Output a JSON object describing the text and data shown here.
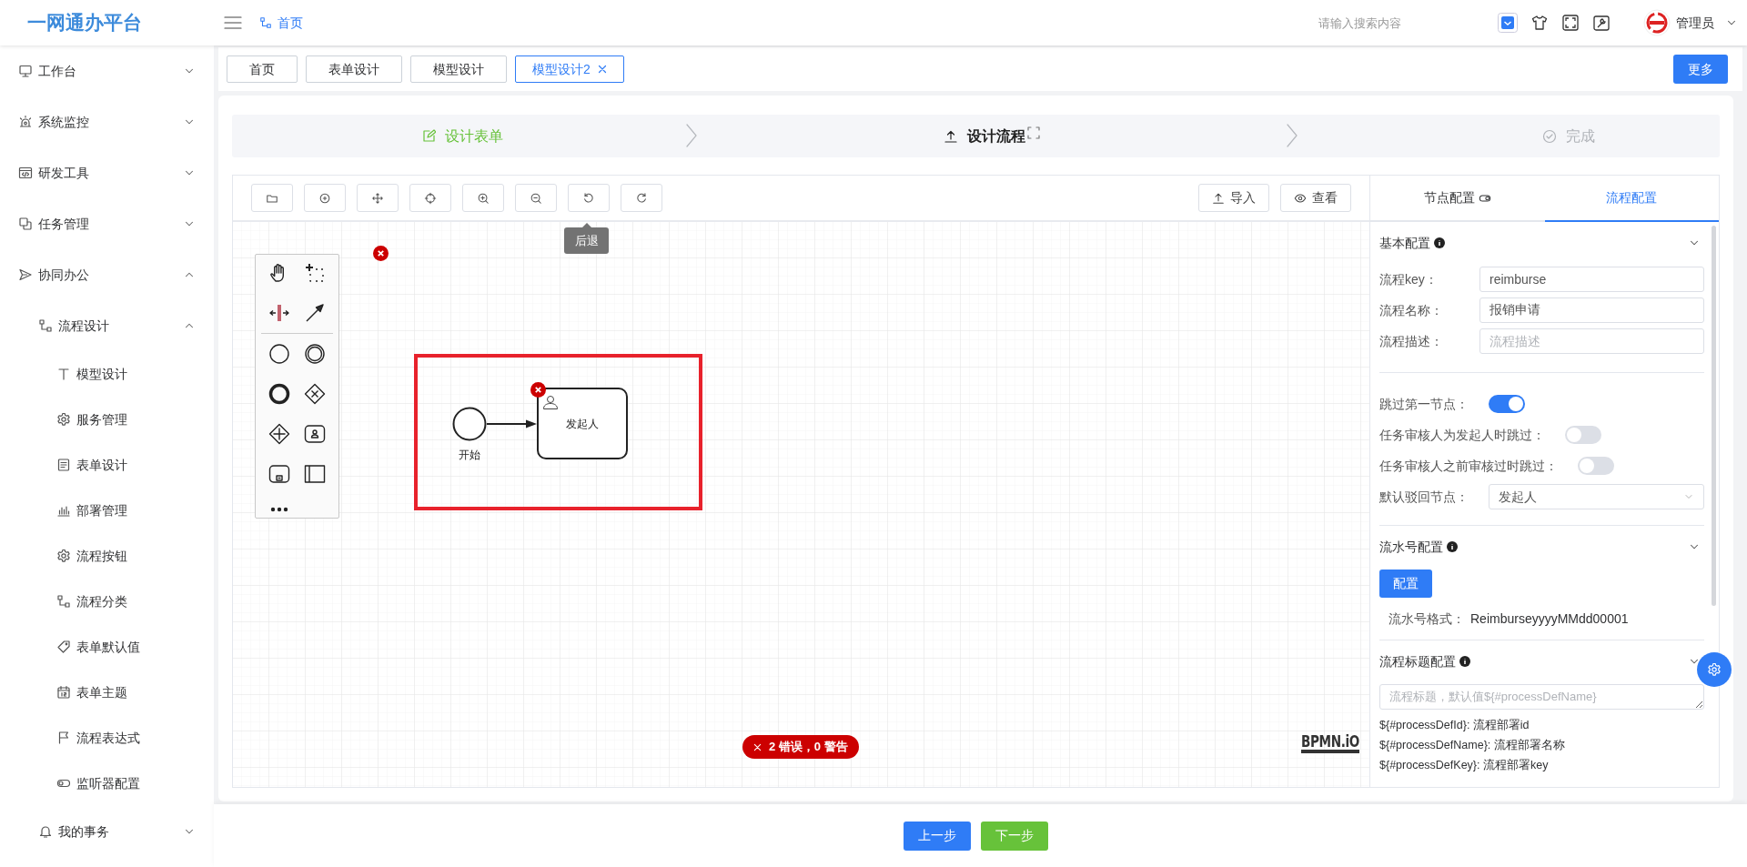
{
  "header": {
    "logo": "一网通办平台",
    "breadcrumb": "首页",
    "search": {
      "placeholder": "请输入搜索内容"
    },
    "user": "管理员"
  },
  "sidebar": {
    "items": [
      {
        "label": "工作台",
        "expanded": false
      },
      {
        "label": "系统监控",
        "expanded": false
      },
      {
        "label": "研发工具",
        "expanded": false
      },
      {
        "label": "任务管理",
        "expanded": false
      },
      {
        "label": "协同办公",
        "expanded": true,
        "children": [
          {
            "label": "流程设计",
            "expanded": true,
            "children": [
              {
                "label": "模型设计"
              },
              {
                "label": "服务管理"
              },
              {
                "label": "表单设计"
              },
              {
                "label": "部署管理"
              },
              {
                "label": "流程按钮"
              },
              {
                "label": "流程分类"
              },
              {
                "label": "表单默认值"
              },
              {
                "label": "表单主题"
              },
              {
                "label": "流程表达式"
              },
              {
                "label": "监听器配置"
              }
            ]
          },
          {
            "label": "我的事务",
            "expanded": false
          }
        ]
      }
    ]
  },
  "tabs": [
    {
      "label": "首页",
      "selected": false
    },
    {
      "label": "表单设计",
      "selected": false
    },
    {
      "label": "模型设计",
      "selected": false
    },
    {
      "label": "模型设计2",
      "selected": true
    }
  ],
  "more_button": "更多",
  "steps": [
    {
      "label": "设计表单",
      "completed": true,
      "selected": false
    },
    {
      "label": "设计流程",
      "completed": false,
      "selected": true
    },
    {
      "label": "完成",
      "completed": false,
      "selected": false
    }
  ],
  "toolbar": {
    "actions": [
      "导入",
      "查看"
    ]
  },
  "canvas": {
    "tooltip": "后退",
    "start_event": "开始",
    "task": "发起人",
    "lint_badge": "2 错误，0 警告",
    "logo": "BPMN.iO"
  },
  "panel": {
    "tabs": [
      {
        "label": "节点配置",
        "selected": false
      },
      {
        "label": "流程配置",
        "selected": true
      }
    ],
    "basic": {
      "title": "基本配置",
      "expanded": true,
      "fields": [
        {
          "label": "流程key：",
          "value": "reimburse"
        },
        {
          "label": "流程名称：",
          "value": "报销申请"
        },
        {
          "label": "流程描述：",
          "placeholder": "流程描述"
        }
      ],
      "switches": [
        {
          "label": "跳过第一节点：",
          "on": true
        },
        {
          "label": "任务审核人为发起人时跳过：",
          "on": false
        },
        {
          "label": "任务审核人之前审核过时跳过：",
          "on": false
        }
      ],
      "select": {
        "label": "默认驳回节点：",
        "value": "发起人"
      }
    },
    "serial": {
      "title": "流水号配置",
      "expanded": true,
      "button": "配置",
      "format_label": "流水号格式：",
      "format_value": "ReimburseyyyyMMdd00001"
    },
    "title_config": {
      "title": "流程标题配置",
      "expanded": true,
      "placeholder": "流程标题，默认值${#processDefName}",
      "variables": [
        "${#processDefId}: 流程部署id",
        "${#processDefName}: 流程部署名称",
        "${#processDefKey}: 流程部署key"
      ]
    }
  },
  "footer": {
    "buttons": [
      "上一步",
      "下一步"
    ]
  }
}
